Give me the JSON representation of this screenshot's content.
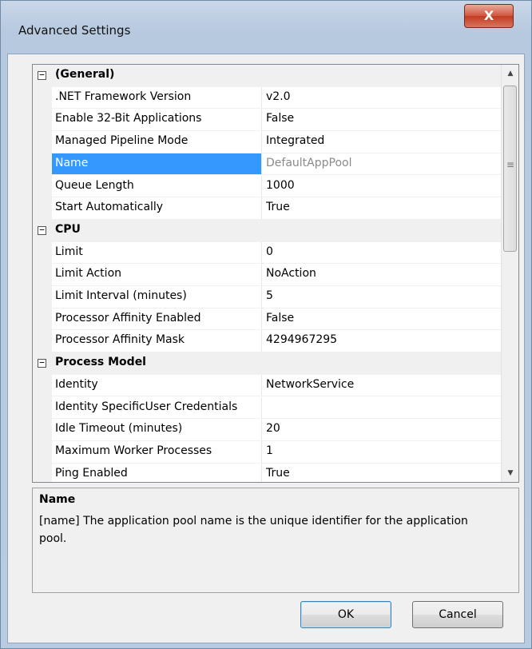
{
  "window": {
    "title": "Advanced Settings",
    "close_label": "X"
  },
  "grid": {
    "categories": [
      {
        "label": "(General)",
        "toggle": "⊟",
        "rows": [
          {
            "name": ".NET Framework Version",
            "value": "v2.0"
          },
          {
            "name": "Enable 32-Bit Applications",
            "value": "False"
          },
          {
            "name": "Managed Pipeline Mode",
            "value": "Integrated"
          },
          {
            "name": "Name",
            "value": "DefaultAppPool"
          },
          {
            "name": "Queue Length",
            "value": "1000"
          },
          {
            "name": "Start Automatically",
            "value": "True"
          }
        ]
      },
      {
        "label": "CPU",
        "toggle": "⊟",
        "rows": [
          {
            "name": "Limit",
            "value": "0"
          },
          {
            "name": "Limit Action",
            "value": "NoAction"
          },
          {
            "name": "Limit Interval (minutes)",
            "value": "5"
          },
          {
            "name": "Processor Affinity Enabled",
            "value": "False"
          },
          {
            "name": "Processor Affinity Mask",
            "value": "4294967295"
          }
        ]
      },
      {
        "label": "Process Model",
        "toggle": "⊟",
        "rows": [
          {
            "name": "Identity",
            "value": "NetworkService"
          },
          {
            "name": "Identity SpecificUser Credentials",
            "value": ""
          },
          {
            "name": "Idle Timeout (minutes)",
            "value": "20"
          },
          {
            "name": "Maximum Worker Processes",
            "value": "1"
          },
          {
            "name": "Ping Enabled",
            "value": "True"
          }
        ]
      }
    ]
  },
  "description": {
    "title": "Name",
    "text": "[name] The application pool name is the unique identifier for the application pool."
  },
  "buttons": {
    "ok_label": "OK",
    "cancel_label": "Cancel"
  },
  "icons": {
    "scroll_up": "▲",
    "scroll_down": "▼",
    "grip": "≡"
  }
}
